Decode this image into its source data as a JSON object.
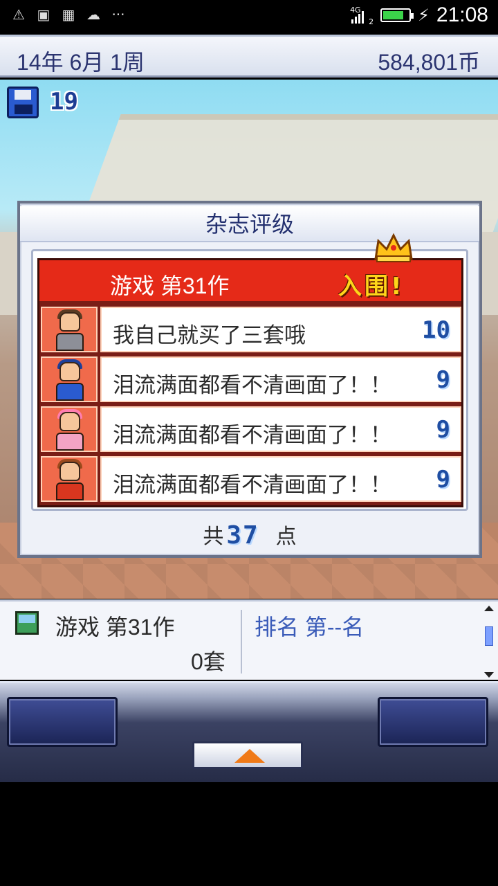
{
  "status_bar": {
    "icons": [
      "warning-icon",
      "image-icon",
      "qr-icon",
      "weather-icon",
      "more-icon"
    ],
    "network": "4G",
    "sim": "2",
    "time": "21:08",
    "battery_level": 0.72
  },
  "top_bar": {
    "date": "14年 6月 1周",
    "money": "584,801币"
  },
  "hud": {
    "save_count": "19"
  },
  "dialog": {
    "title": "杂志评级",
    "game_title": "游戏 第31作",
    "award_text": "入围!",
    "reviews": [
      {
        "comment": "我自己就买了三套哦",
        "score": "10"
      },
      {
        "comment": "泪流满面都看不清画面了！！",
        "score": "9"
      },
      {
        "comment": "泪流满面都看不清画面了！！",
        "score": "9"
      },
      {
        "comment": "泪流满面都看不清画面了！！",
        "score": "9"
      }
    ],
    "total_prefix": "共",
    "total_value": "37",
    "total_suffix": "点"
  },
  "info_panel": {
    "game_name": "游戏 第31作",
    "sold": "0套",
    "rank": "排名 第--名"
  },
  "colors": {
    "header_red": "#e52a18",
    "award_gold": "#ffd51a",
    "score_blue": "#1f4ea3",
    "title_navy": "#23306f"
  }
}
